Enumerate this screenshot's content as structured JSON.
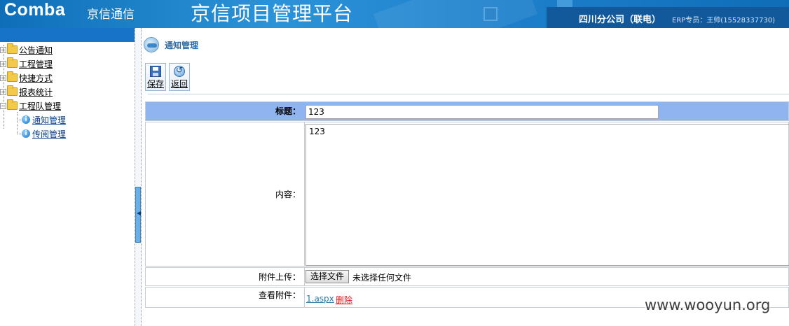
{
  "header": {
    "logo": "Comba",
    "logo_cn": "京信通信",
    "platform_title": "京信项目管理平台",
    "company": "四川分公司（联电）",
    "erp": "ERP专员：王帅(15528337730)"
  },
  "sidebar": {
    "items": [
      {
        "label": "公告通知"
      },
      {
        "label": "工程管理"
      },
      {
        "label": "快捷方式"
      },
      {
        "label": "报表统计"
      },
      {
        "label": "工程队管理"
      }
    ],
    "sub_items": [
      {
        "label": "通知管理"
      },
      {
        "label": "传阅管理"
      }
    ]
  },
  "main": {
    "page_title": "通知管理",
    "toolbar": {
      "save_label": "保存",
      "back_label": "返回"
    },
    "form": {
      "title_label": "标题：",
      "title_value": "123",
      "content_label": "内容：",
      "content_value": "123",
      "upload_label": "附件上传：",
      "file_button": "选择文件",
      "file_status": "未选择任何文件",
      "view_label": "查看附件：",
      "attachment_name": "1.aspx",
      "delete_label": "删除"
    }
  },
  "watermark": "www.wooyun.org",
  "colors": {
    "header_bg": "#1d7fcb",
    "title_row_bg": "#8fb4f0",
    "page_title": "#2b6aa5",
    "delete_link": "#e01a1a"
  }
}
